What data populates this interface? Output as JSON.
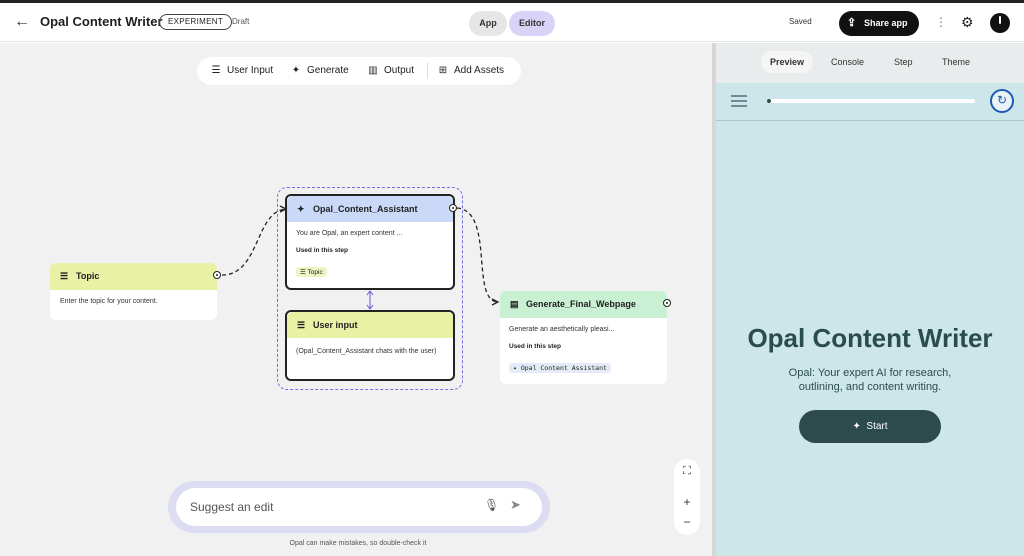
{
  "header": {
    "title": "Opal Content Writer",
    "badge": "EXPERIMENT",
    "status": "Draft",
    "mode_tabs": [
      "App",
      "Editor"
    ],
    "saved": "Saved",
    "share_label": "Share app"
  },
  "toolbar": {
    "items": [
      "User Input",
      "Generate",
      "Output",
      "Add Assets"
    ]
  },
  "nodes": {
    "topic": {
      "title": "Topic",
      "body": "Enter the topic for your content."
    },
    "assistant": {
      "title": "Opal_Content_Assistant",
      "body": "You are Opal, an expert content ...",
      "used_label": "Used in this step",
      "chip": "Topic"
    },
    "user_input": {
      "title": "User input",
      "body": "(Opal_Content_Assistant chats with the user)"
    },
    "generate": {
      "title": "Generate_Final_Webpage",
      "body": "Generate an aesthetically pleasi...",
      "used_label": "Used in this step",
      "chip": "Opal Content Assistant"
    }
  },
  "prompt": {
    "placeholder": "Suggest an edit",
    "disclaimer": "Opal can make mistakes, so double-check it"
  },
  "zoom": {
    "in": "+",
    "out": "−"
  },
  "panel": {
    "tabs": [
      "Preview",
      "Console",
      "Step",
      "Theme"
    ],
    "active_tab": "Preview",
    "progress": 0.01,
    "app_title": "Opal Content Writer",
    "app_subtitle": "Opal: Your expert AI for research, outlining, and content writing.",
    "start_label": "Start"
  },
  "colors": {
    "input_node": "#e9f2a4",
    "generate_node": "#c9d9f7",
    "output_node": "#c9f0d2",
    "editor_tab": "#d9d3f7",
    "preview_bg": "#cde6e9",
    "brand_dark": "#2b4c4e"
  },
  "icons": {
    "back": "arrow-left-icon",
    "share": "share-icon",
    "more": "more-vertical-icon",
    "settings": "gear-icon",
    "user_input": "input-icon",
    "generate": "sparkle-icon",
    "output": "output-icon",
    "add_assets": "add-box-icon",
    "mic": "mic-icon",
    "send": "send-icon",
    "fit": "fit-screen-icon",
    "menu": "menu-icon",
    "restart": "restart-icon"
  }
}
